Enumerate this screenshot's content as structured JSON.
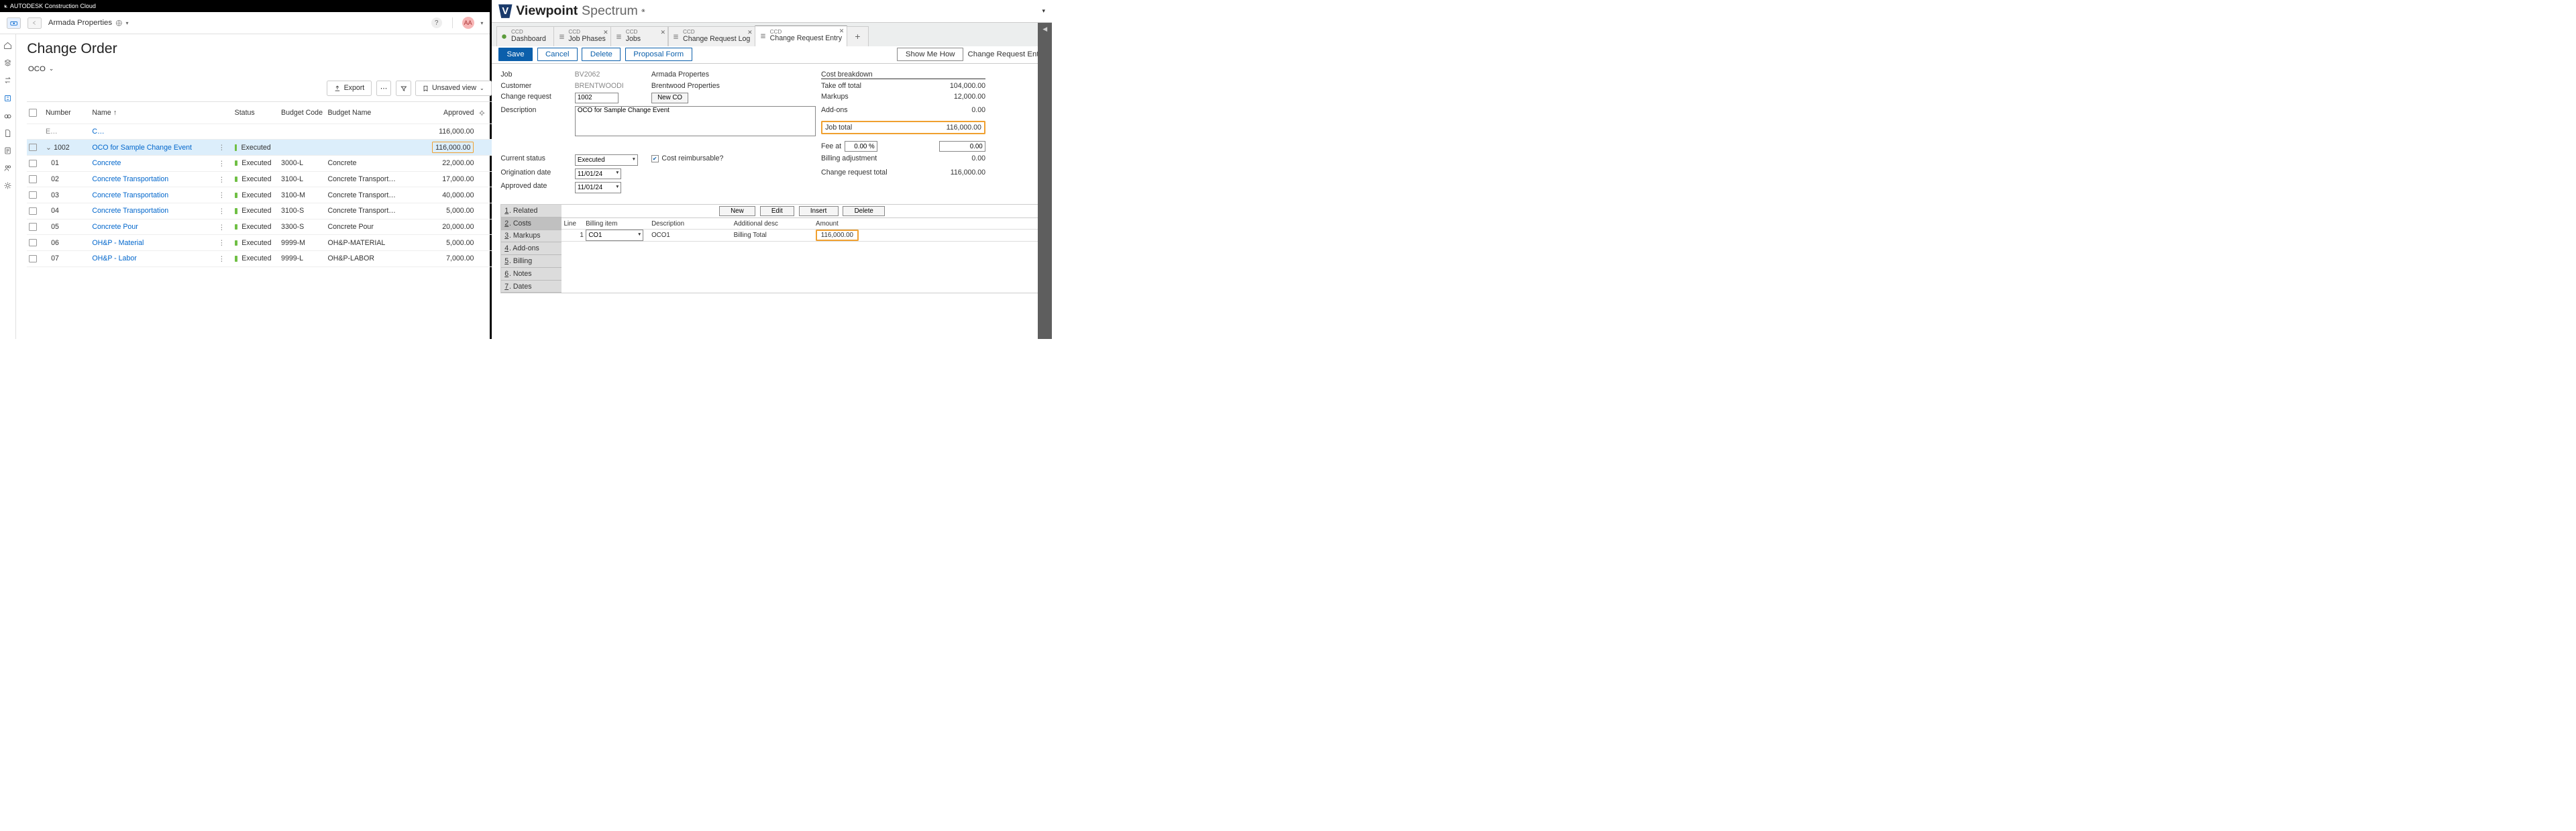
{
  "acc": {
    "brand": "AUTODESK Construction Cloud",
    "project": "Armada Properties",
    "avatar_initials": "AA",
    "page_title": "Change Order",
    "tab_selected": "OCO",
    "toolbar": {
      "export_label": "Export",
      "view_label": "Unsaved view"
    },
    "columns": {
      "number": "Number",
      "name": "Name",
      "status": "Status",
      "budget_code": "Budget Code",
      "budget_name": "Budget Name",
      "approved": "Approved"
    },
    "summary_row": {
      "prefix": "E…",
      "link": "C…",
      "approved": "116,000.00"
    },
    "rows": [
      {
        "num": "1002",
        "name": "OCO for Sample Change Event",
        "status": "Executed",
        "code": "",
        "bname": "",
        "approved": "116,000.00",
        "parent": true,
        "highlight": true
      },
      {
        "num": "01",
        "name": "Concrete",
        "status": "Executed",
        "code": "3000-L",
        "bname": "Concrete",
        "approved": "22,000.00"
      },
      {
        "num": "02",
        "name": "Concrete Transportation",
        "status": "Executed",
        "code": "3100-L",
        "bname": "Concrete Transport…",
        "approved": "17,000.00"
      },
      {
        "num": "03",
        "name": "Concrete Transportation",
        "status": "Executed",
        "code": "3100-M",
        "bname": "Concrete Transport…",
        "approved": "40,000.00"
      },
      {
        "num": "04",
        "name": "Concrete Transportation",
        "status": "Executed",
        "code": "3100-S",
        "bname": "Concrete Transport…",
        "approved": "5,000.00"
      },
      {
        "num": "05",
        "name": "Concrete Pour",
        "status": "Executed",
        "code": "3300-S",
        "bname": "Concrete Pour",
        "approved": "20,000.00"
      },
      {
        "num": "06",
        "name": "OH&P - Material",
        "status": "Executed",
        "code": "9999-M",
        "bname": "OH&P-MATERIAL",
        "approved": "5,000.00"
      },
      {
        "num": "07",
        "name": "OH&P - Labor",
        "status": "Executed",
        "code": "9999-L",
        "bname": "OH&P-LABOR",
        "approved": "7,000.00"
      }
    ]
  },
  "vp": {
    "brand_bold": "Viewpoint",
    "brand_light": "Spectrum",
    "tabs": [
      {
        "sub": "CCD",
        "main": "Dashboard",
        "icon": "home"
      },
      {
        "sub": "CCD",
        "main": "Job Phases",
        "icon": "list",
        "close": true
      },
      {
        "sub": "CCD",
        "main": "Jobs",
        "icon": "list",
        "close": true
      },
      {
        "sub": "CCD",
        "main": "Change Request Log",
        "icon": "list",
        "close": true
      },
      {
        "sub": "CCD",
        "main": "Change Request Entry",
        "icon": "list",
        "close": true,
        "active": true
      }
    ],
    "toolbar": {
      "save": "Save",
      "cancel": "Cancel",
      "delete": "Delete",
      "proposal": "Proposal Form",
      "show_me": "Show Me How",
      "crumb": "Change Request Entry"
    },
    "fields": {
      "job_lbl": "Job",
      "job_val": "BV2062",
      "customer_lbl": "Customer",
      "customer_val": "BRENTWOODI",
      "cr_lbl": "Change request",
      "cr_val": "1002",
      "newco_btn": "New CO",
      "desc_lbl": "Description",
      "desc_val": "OCO for Sample Change Event",
      "company_name": "Armada Propertes",
      "customer_name": "Brentwood Properties",
      "curstatus_lbl": "Current status",
      "curstatus_val": "Executed",
      "reimb_lbl": "Cost reimbursable?",
      "orig_lbl": "Origination date",
      "orig_val": "11/01/24",
      "appr_lbl": "Approved date",
      "appr_val": "11/01/24"
    },
    "cost": {
      "header": "Cost breakdown",
      "takeoff_lbl": "Take off total",
      "takeoff_val": "104,000.00",
      "markups_lbl": "Markups",
      "markups_val": "12,000.00",
      "addons_lbl": "Add-ons",
      "addons_val": "0.00",
      "jobtotal_lbl": "Job total",
      "jobtotal_val": "116,000.00",
      "feeat_lbl": "Fee at",
      "feeat_pct": "0.00 %",
      "feeat_val": "0.00",
      "billadj_lbl": "Billing adjustment",
      "billadj_val": "0.00",
      "crtotal_lbl": "Change request total",
      "crtotal_val": "116,000.00"
    },
    "sub": {
      "tabs": [
        "Related",
        "Costs",
        "Markups",
        "Add-ons",
        "Billing",
        "Notes",
        "Dates"
      ],
      "active_idx": 1,
      "btns": {
        "new": "New",
        "edit": "Edit",
        "insert": "Insert",
        "delete": "Delete"
      },
      "cols": {
        "line": "Line",
        "item": "Billing item",
        "desc": "Description",
        "adddesc": "Additional desc",
        "amount": "Amount"
      },
      "row": {
        "line": "1",
        "item": "CO1",
        "desc": "OCO1",
        "adddesc": "Billing Total",
        "amount": "116,000.00"
      }
    }
  }
}
